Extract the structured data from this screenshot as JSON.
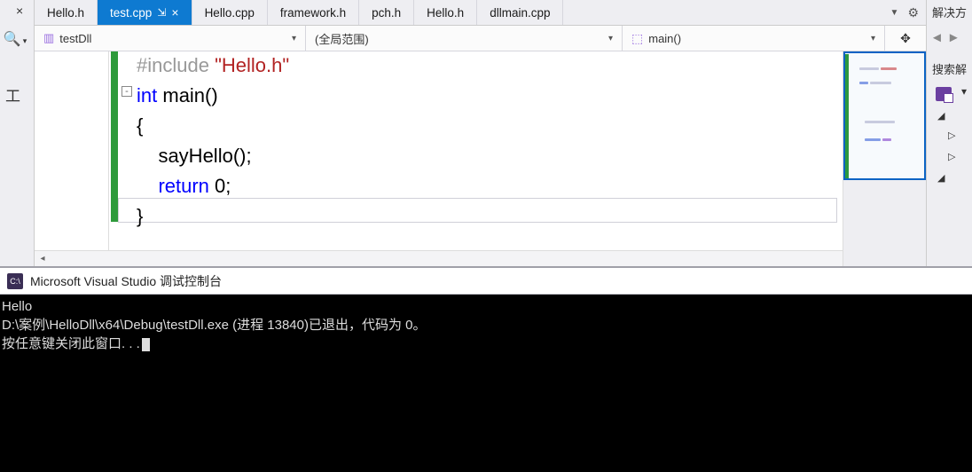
{
  "tabs": [
    {
      "label": "Hello.h"
    },
    {
      "label": "test.cpp",
      "active": true,
      "pinned": true
    },
    {
      "label": "Hello.cpp"
    },
    {
      "label": "framework.h"
    },
    {
      "label": "pch.h"
    },
    {
      "label": "Hello.h"
    },
    {
      "label": "dllmain.cpp"
    }
  ],
  "nav": {
    "scope_project": "testDll",
    "scope_range": "(全局范围)",
    "scope_func": "main()"
  },
  "code": {
    "include_directive": "#include ",
    "include_file": "\"Hello.h\"",
    "kw_int": "int",
    "fn_main": " main()",
    "brace_open": "{",
    "call_sayHello": "    sayHello();",
    "kw_return": "    return",
    "ret_val": " 0",
    "semicolon": ";",
    "brace_close": "}",
    "outline": "-"
  },
  "side": {
    "title": "解决方",
    "search": "搜索解"
  },
  "console": {
    "title": "Microsoft Visual Studio 调试控制台",
    "line1": "Hello",
    "line2": "D:\\案例\\HelloDll\\x64\\Debug\\testDll.exe (进程 13840)已退出，代码为 0。",
    "line3": "按任意键关闭此窗口. . ."
  }
}
